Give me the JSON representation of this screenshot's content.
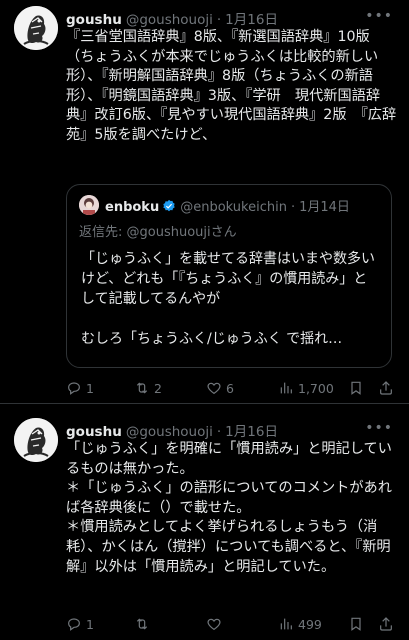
{
  "tweets": [
    {
      "name": "goushu",
      "handle": "@goushouoji",
      "date": "1月16日",
      "text": "『三省堂国語辞典』8版、『新選国語辞典』10版（ちょうふくが本来でじゅうふくは比較的新しい形）、『新明解国語辞典』8版（ちょうふくの新語形）、『明鏡国語辞典』3版、『学研　現代新国語辞典』改訂6版、『見やすい現代国語辞典』2版　『広辞苑』5版を調べたけど、",
      "quote": {
        "name": "enboku",
        "handle": "@enbokukeichin",
        "date": "1月14日",
        "reply_prefix": "返信先: ",
        "reply_handle": "@goushuoujiさん",
        "text": "「じゅうふく」を載せてる辞書はいまや数多いけど、どれも「『ちょうふく』の慣用読み」として記載してるんやが\n\nむしろ「ちょうふく/じゅうふく で揺れ…"
      },
      "replies": "1",
      "retweets": "2",
      "likes": "6",
      "views": "1,700"
    },
    {
      "name": "goushu",
      "handle": "@goushouoji",
      "date": "1月16日",
      "text": "「じゅうふく」を明確に「慣用読み」と明記しているものは無かった。\n＊「じゅうふく」の語形についてのコメントがあれば各辞典後に（）で載せた。\n＊慣用読みとしてよく挙げられるしょうもう（消耗）、かくはん（撹拌）についても調べると、『新明解』以外は「慣用読み」と明記していた。",
      "replies": "1",
      "retweets": "",
      "likes": "",
      "views": "499"
    }
  ],
  "icons": {
    "more": "more-dots-icon",
    "reply": "reply-bubble-icon",
    "retweet": "retweet-icon",
    "like": "heart-icon",
    "views": "views-bars-icon",
    "bookmark": "bookmark-icon",
    "share": "share-icon",
    "verified": "verified-badge-icon"
  },
  "colors": {
    "background": "#000000",
    "text": "#e7e9ea",
    "muted": "#71767b",
    "verified": "#1d9bf0"
  }
}
